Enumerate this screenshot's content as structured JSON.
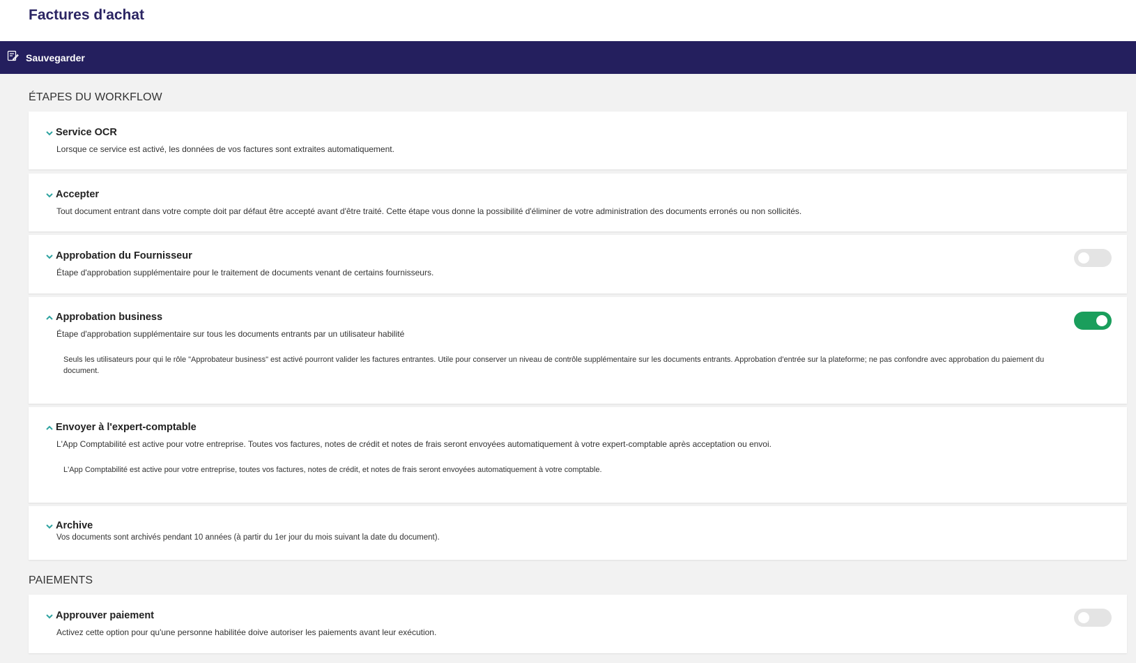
{
  "header": {
    "title": "Factures d'achat"
  },
  "toolbar": {
    "save_label": "Sauvegarder",
    "save_icon": "save-doc-icon"
  },
  "colors": {
    "brand": "#241f5e",
    "toggle_on": "#1a9e5c",
    "toggle_off": "#e4e4e4",
    "chevron": "#2ea3a0"
  },
  "sections": {
    "workflow_title": "ÉTAPES DU WORKFLOW",
    "payments_title": "PAIEMENTS"
  },
  "steps": {
    "ocr": {
      "title": "Service OCR",
      "desc": "Lorsque ce service est activé, les données de vos factures sont extraites automatiquement.",
      "expanded": false
    },
    "accept": {
      "title": "Accepter",
      "desc": "Tout document entrant dans votre compte doit par défaut être accepté avant d'être traité. Cette étape vous donne la possibilité d'éliminer de votre administration des documents erronés ou non sollicités.",
      "expanded": false
    },
    "supplier": {
      "title": "Approbation du Fournisseur",
      "desc": "Étape d'approbation supplémentaire pour le traitement de documents venant de certains fournisseurs.",
      "expanded": false,
      "enabled": false
    },
    "business": {
      "title": "Approbation business",
      "desc": "Étape d'approbation supplémentaire sur tous les documents entrants par un utilisateur habilité",
      "detail": "Seuls les utilisateurs pour qui le rôle \"Approbateur business\" est activé pourront valider les factures entrantes. Utile pour conserver un niveau de contrôle supplémentaire sur les documents entrants. Approbation d'entrée sur la plateforme; ne pas confondre avec approbation du paiement du document.",
      "expanded": true,
      "enabled": true
    },
    "accountant": {
      "title": "Envoyer à l'expert-comptable",
      "desc": "L'App Comptabilité est active pour votre entreprise. Toutes vos factures, notes de crédit et notes de frais seront envoyées automatiquement à votre expert-comptable après acceptation ou envoi.",
      "detail": "L'App Comptabilité est active pour votre entreprise, toutes vos factures, notes de crédit, et notes de frais seront envoyées automatiquement à votre comptable.",
      "expanded": true
    },
    "archive": {
      "title": "Archive",
      "desc": "Vos documents sont archivés pendant 10 années (à partir du 1er jour du mois suivant la date du document).",
      "expanded": false
    }
  },
  "payments": {
    "approve": {
      "title": "Approuver paiement",
      "desc": "Activez cette option pour qu'une personne habilitée doive autoriser les paiements avant leur exécution.",
      "expanded": false,
      "enabled": false
    }
  }
}
